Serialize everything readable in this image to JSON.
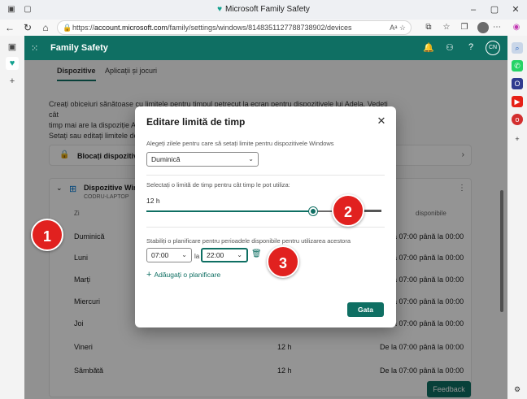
{
  "window": {
    "title": "Microsoft Family Safety"
  },
  "address_bar": {
    "url_prefix": "https://",
    "url_host": "account.microsoft.com",
    "url_path": "/family/settings/windows/8148351127788738902/devices"
  },
  "app": {
    "name": "Family Safety",
    "user_initials": "CN"
  },
  "tabs": [
    {
      "label": "Dispozitive",
      "active": true
    },
    {
      "label": "Aplicații și jocuri",
      "active": false
    }
  ],
  "intro": {
    "line1": "Creați obiceiuri sănătoase cu limitele pentru timpul petrecut la ecran pentru dispozitivele lui Adela. Vedeți cât",
    "line2": "timp mai are la dispoziție Adela",
    "line3": "Setați sau editați limitele de ti"
  },
  "lock_card": {
    "label": "Blocați dispozitivele"
  },
  "device": {
    "name": "Dispozitive Windows",
    "sub": "CODRU-LAPTOP",
    "columns": {
      "day": "Zi",
      "available": "disponibile"
    },
    "rows": [
      {
        "day": "Duminică",
        "hours": "",
        "avail": "De la 07:00 până la 00:00"
      },
      {
        "day": "Luni",
        "hours": "",
        "avail": "De la 07:00 până la 00:00"
      },
      {
        "day": "Marți",
        "hours": "",
        "avail": "De la 07:00 până la 00:00"
      },
      {
        "day": "Miercuri",
        "hours": "",
        "avail": "De la 07:00 până la 00:00"
      },
      {
        "day": "Joi",
        "hours": "",
        "avail": "De la 07:00 până la 00:00"
      },
      {
        "day": "Vineri",
        "hours": "12 h",
        "avail": "De la 07:00 până la 00:00"
      },
      {
        "day": "Sâmbătă",
        "hours": "12 h",
        "avail": "De la 07:00 până la 00:00"
      }
    ]
  },
  "feedback_label": "Feedback",
  "dialog": {
    "title": "Editare limită de timp",
    "days_label": "Alegeți zilele pentru care să setați limite pentru dispozitivele Windows",
    "day_selected": "Duminică",
    "limit_label": "Selectați o limită de timp pentru cât timp le pot utiliza:",
    "limit_value": "12 h",
    "limit_fraction": 0.71,
    "schedule_label": "Stabiliți o planificare pentru perioadele disponibile pentru utilizarea acestora",
    "from": "07:00",
    "between": "la",
    "to": "22:00",
    "add_schedule": "Adăugați o planificare",
    "done": "Gata"
  },
  "callouts": [
    "1",
    "2",
    "3"
  ]
}
